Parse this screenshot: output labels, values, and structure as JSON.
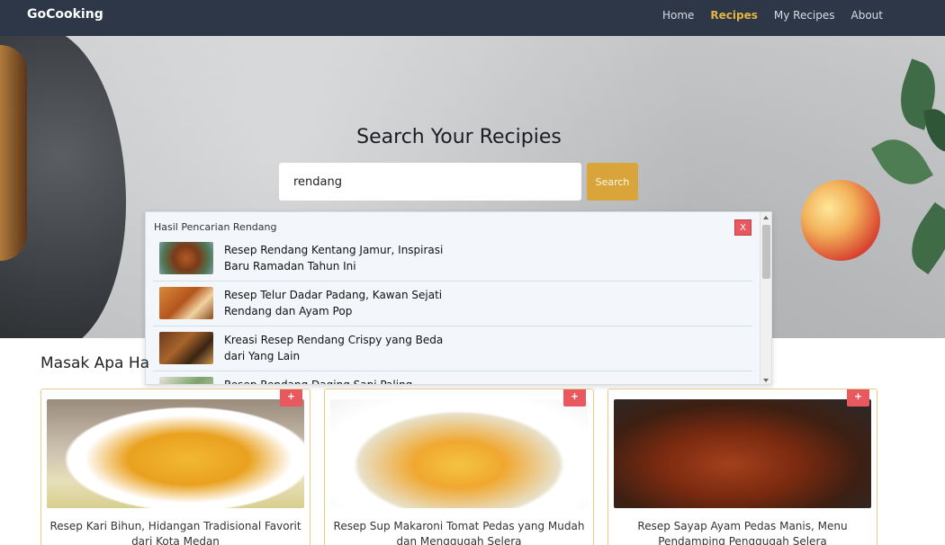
{
  "nav": {
    "brand": "GoCooking",
    "links": [
      "Home",
      "Recipes",
      "My Recipes",
      "About"
    ],
    "active": "Recipes"
  },
  "hero": {
    "title": "Search Your Recipies",
    "search_value": "rendang",
    "search_button": "Search"
  },
  "results": {
    "title": "Hasil Pencarian Rendang",
    "close_label": "X",
    "items": [
      {
        "title": "Resep Rendang Kentang Jamur, Inspirasi Baru Ramadan Tahun Ini"
      },
      {
        "title": "Resep Telur Dadar Padang, Kawan Sejati Rendang dan Ayam Pop"
      },
      {
        "title": "Kreasi Resep Rendang Crispy yang Beda dari Yang Lain"
      },
      {
        "title": "Resep Rendang Daging Sapi Paling"
      }
    ]
  },
  "section": {
    "title": "Masak Apa Ha"
  },
  "cards": [
    {
      "title": "Resep Kari Bihun, Hidangan Tradisional Favorit dari Kota Medan",
      "add_label": "+"
    },
    {
      "title": "Resep Sup Makaroni Tomat Pedas yang Mudah dan Menggugah Selera",
      "add_label": "+"
    },
    {
      "title": "Resep Sayap Ayam Pedas Manis, Menu Pendamping Penggugah Selera",
      "add_label": "+"
    }
  ],
  "colors": {
    "navbar": "#2e3747",
    "accent": "#e3b541",
    "search_button": "#d9a43a",
    "close_button": "#e8595f"
  }
}
